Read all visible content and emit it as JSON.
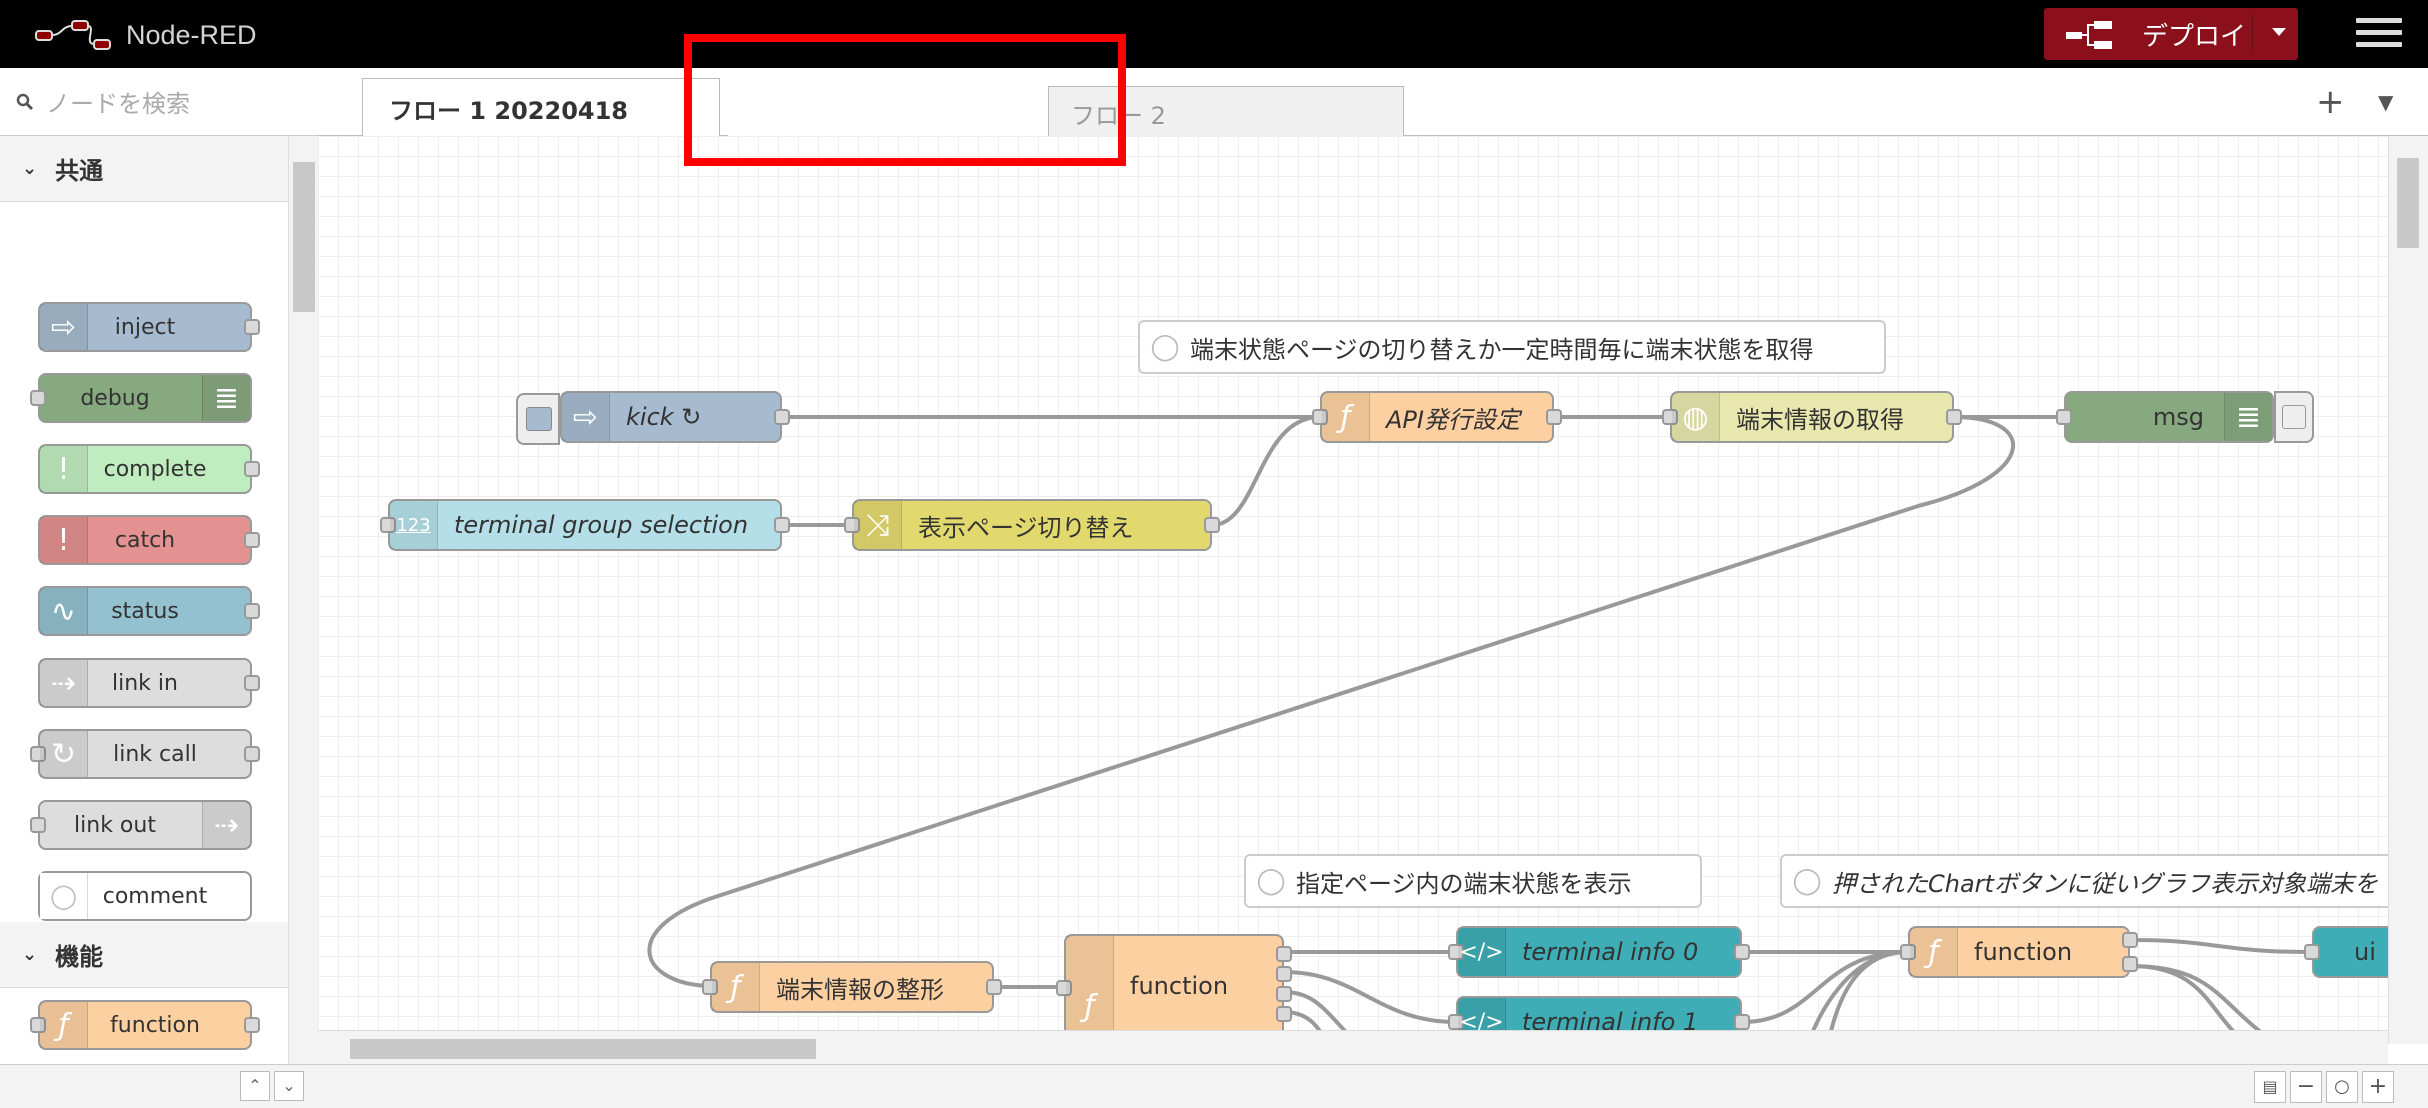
{
  "app": {
    "title": "Node-RED",
    "deploy_label": "デプロイ"
  },
  "palette": {
    "search_placeholder": "ノードを検索",
    "categories": [
      {
        "label": "共通",
        "nodes": [
          {
            "label": "inject",
            "color": "#a6bbcf"
          },
          {
            "label": "debug",
            "color": "#87a980"
          },
          {
            "label": "complete",
            "color": "#c0edc0"
          },
          {
            "label": "catch",
            "color": "#e49191"
          },
          {
            "label": "status",
            "color": "#94c1d0"
          },
          {
            "label": "link in",
            "color": "#dddddd"
          },
          {
            "label": "link call",
            "color": "#dddddd"
          },
          {
            "label": "link out",
            "color": "#dddddd"
          },
          {
            "label": "comment",
            "color": "#ffffff"
          }
        ]
      },
      {
        "label": "機能",
        "nodes": [
          {
            "label": "function",
            "color": "#fdd0a2"
          }
        ]
      }
    ]
  },
  "tabs": [
    {
      "label": "フロー 1 20220418",
      "active": true
    },
    {
      "label": "フロー 2",
      "active": false
    }
  ],
  "flow": {
    "comments": [
      "端末状態ページの切り替えか一定時間毎に端末状態を取得",
      "指定ページ内の端末状態を表示",
      "押されたChartボタンに従いグラフ表示対象端末を"
    ],
    "nodes": {
      "kick": "kick ↻",
      "api": "API発行設定",
      "http": "端末情報の取得",
      "msg": "msg",
      "tgs": "terminal group selection",
      "page": "表示ページ切り替え",
      "format": "端末情報の整形",
      "function1": "function",
      "ti0": "terminal info 0",
      "ti1": "terminal info 1",
      "function2": "function",
      "ui": "ui"
    }
  }
}
